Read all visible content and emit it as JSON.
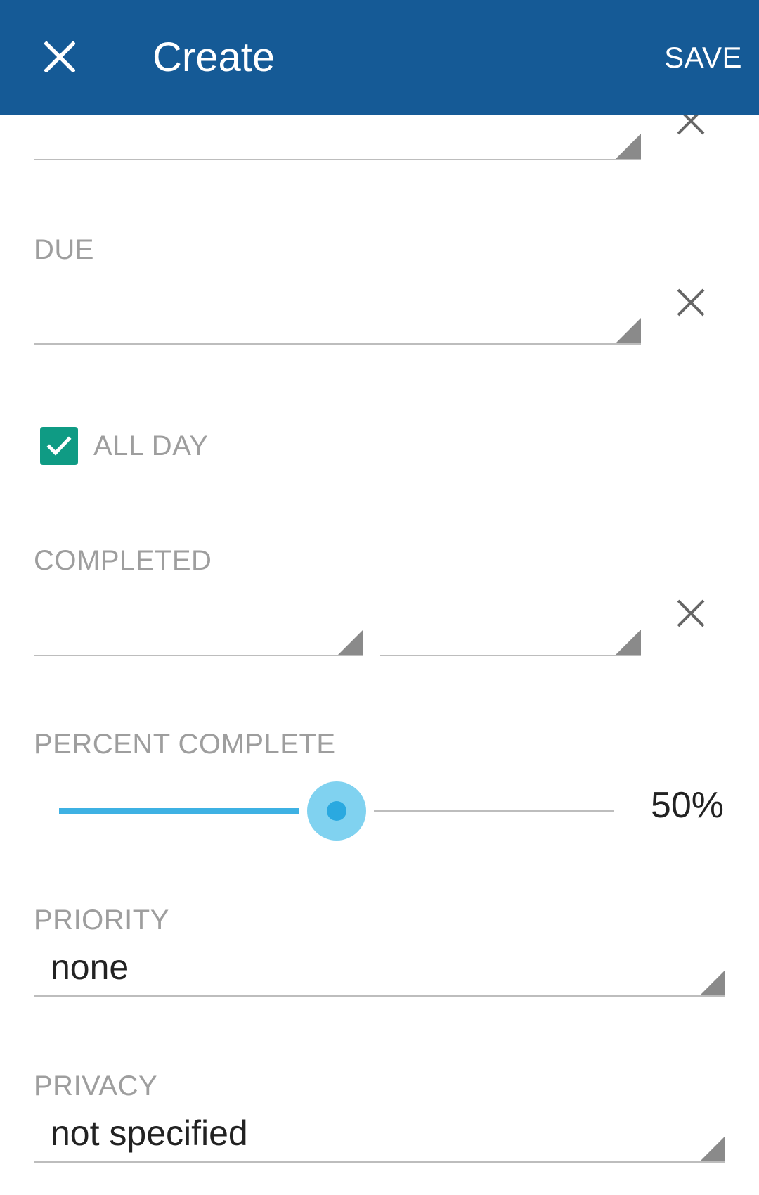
{
  "app_bar": {
    "title": "Create",
    "save_label": "SAVE",
    "close_icon": "close-icon",
    "background_color": "#155a96"
  },
  "start": {
    "clear_icon": "clear-icon"
  },
  "due": {
    "label": "DUE",
    "clear_icon": "clear-icon"
  },
  "all_day": {
    "label": "ALL DAY",
    "checked": true,
    "check_color": "#0f9b84"
  },
  "completed": {
    "label": "COMPLETED",
    "clear_icon": "clear-icon"
  },
  "percent_complete": {
    "label": "PERCENT COMPLETE",
    "value": 50,
    "value_text": "50%",
    "accent_color": "#3eb1e3"
  },
  "priority": {
    "label": "PRIORITY",
    "selected": "none"
  },
  "privacy": {
    "label": "PRIVACY",
    "selected": "not specified"
  }
}
